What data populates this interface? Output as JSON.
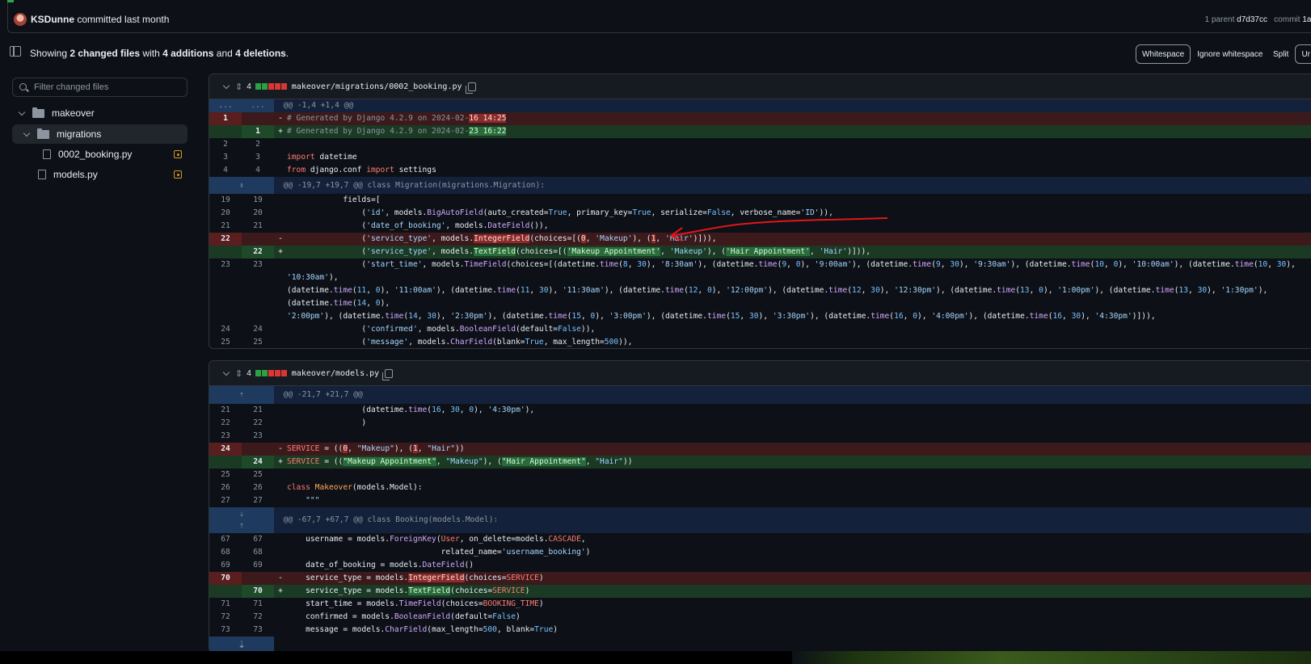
{
  "commit": {
    "author": "KSDunne",
    "action": "committed last month",
    "parent_label": "1 parent",
    "parent_sha": "d7d37cc",
    "commit_label": "commit",
    "commit_sha": "1ae"
  },
  "summary": {
    "prefix": "Showing ",
    "files": "2 changed files",
    "mid": " with ",
    "additions": "4 additions",
    "and": " and ",
    "deletions": "4 deletions",
    "suffix": "."
  },
  "toolbar": {
    "whitespace": "Whitespace",
    "ignore_whitespace": "Ignore whitespace",
    "split": "Split",
    "unified": "Ur"
  },
  "sidebar": {
    "filter_placeholder": "Filter changed files",
    "tree": [
      {
        "label": "makeover"
      },
      {
        "label": "migrations"
      },
      {
        "label": "0002_booking.py"
      },
      {
        "label": "models.py"
      }
    ]
  },
  "files": [
    {
      "count": "4",
      "name": "makeover/migrations/0002_booking.py"
    },
    {
      "count": "4",
      "name": "makeover/models.py"
    }
  ],
  "colors": {
    "accent_add": "#2ea043",
    "accent_del": "#da3633",
    "annotation": "#e0161a"
  }
}
